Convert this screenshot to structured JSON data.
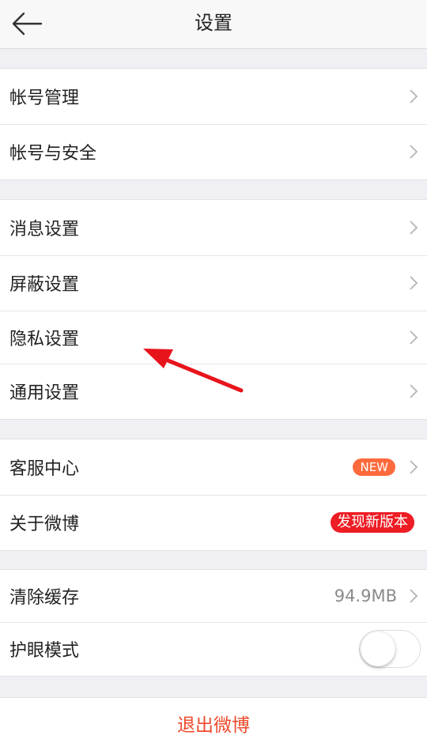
{
  "header": {
    "title": "设置",
    "back_icon": "arrow-left-icon"
  },
  "groups": [
    {
      "items": [
        {
          "label": "帐号管理"
        },
        {
          "label": "帐号与安全"
        }
      ]
    },
    {
      "items": [
        {
          "label": "消息设置"
        },
        {
          "label": "屏蔽设置"
        },
        {
          "label": "隐私设置"
        },
        {
          "label": "通用设置"
        }
      ]
    },
    {
      "items": [
        {
          "label": "客服中心",
          "badge": "NEW"
        },
        {
          "label": "关于微博",
          "badge": "发现新版本"
        }
      ]
    },
    {
      "items": [
        {
          "label": "清除缓存",
          "value": "94.9MB"
        },
        {
          "label": "护眼模式",
          "toggle_on": false
        }
      ]
    }
  ],
  "logout": {
    "label": "退出微博"
  },
  "colors": {
    "background": "#efeff4",
    "new_badge": "#ff6a3d",
    "version_badge": "#ee1c24",
    "logout_text": "#ee4a2b",
    "annotation_arrow": "#e8141c"
  }
}
